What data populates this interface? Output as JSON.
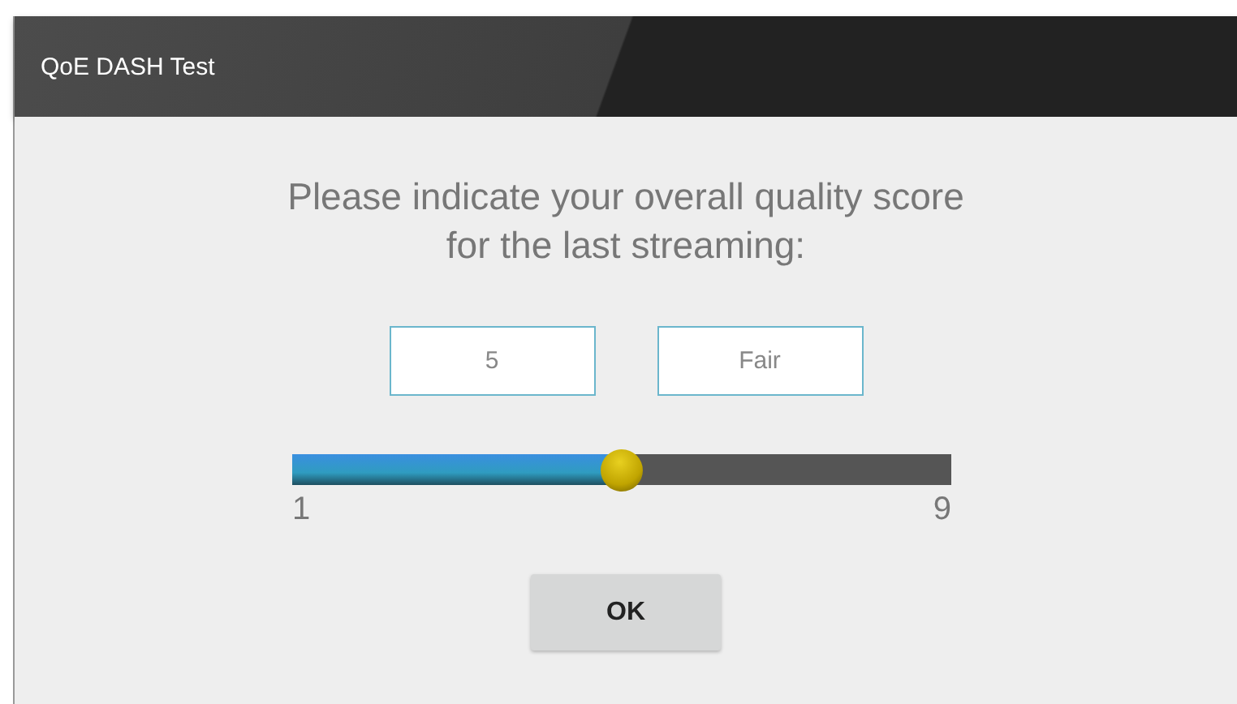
{
  "window": {
    "title": "QoE DASH Test"
  },
  "prompt": {
    "line_1": "Please indicate your overall quality score",
    "line_2": "for the last streaming:"
  },
  "score": {
    "value": "5",
    "rating": "Fair"
  },
  "slider": {
    "level": 0.5,
    "min_label": "1",
    "max_label": "9"
  },
  "buttons": [
    "OK"
  ]
}
